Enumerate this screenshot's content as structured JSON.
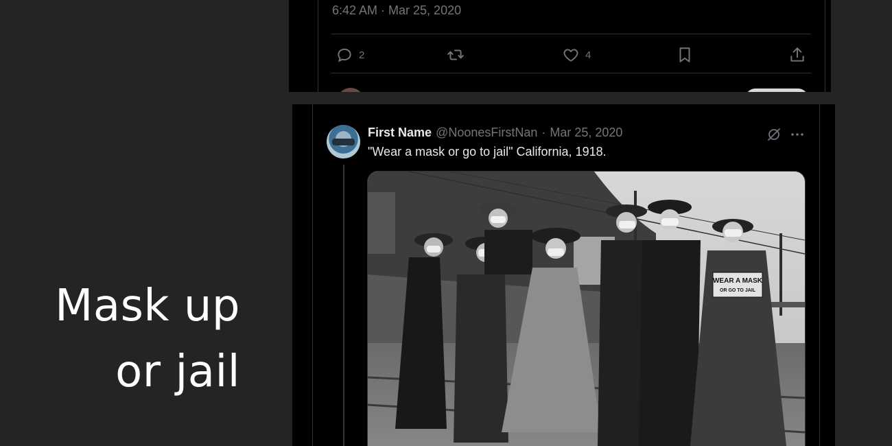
{
  "colors": {
    "page_bg": "#242424",
    "card_bg": "#000000",
    "text_primary": "#e7e9ea",
    "text_muted": "#71767b"
  },
  "headline": {
    "line1": "Mask up",
    "line2": "or jail"
  },
  "prev_tweet": {
    "timestamp": "6:42 AM · Mar 25, 2020",
    "actions": {
      "reply_count": "2",
      "retweet_count": "",
      "like_count": "4",
      "icons": [
        "reply-icon",
        "retweet-icon",
        "like-icon",
        "bookmark-icon",
        "share-icon"
      ]
    }
  },
  "tweet": {
    "display_name": "First Name",
    "handle": "@NoonesFirstNan",
    "separator": "·",
    "date": "Mar 25, 2020",
    "text": "\"Wear a mask or go to jail\" California,  1918.",
    "photo": {
      "sign_line1": "WEAR A MASK",
      "sign_line2": "OR GO TO JAIL"
    }
  }
}
